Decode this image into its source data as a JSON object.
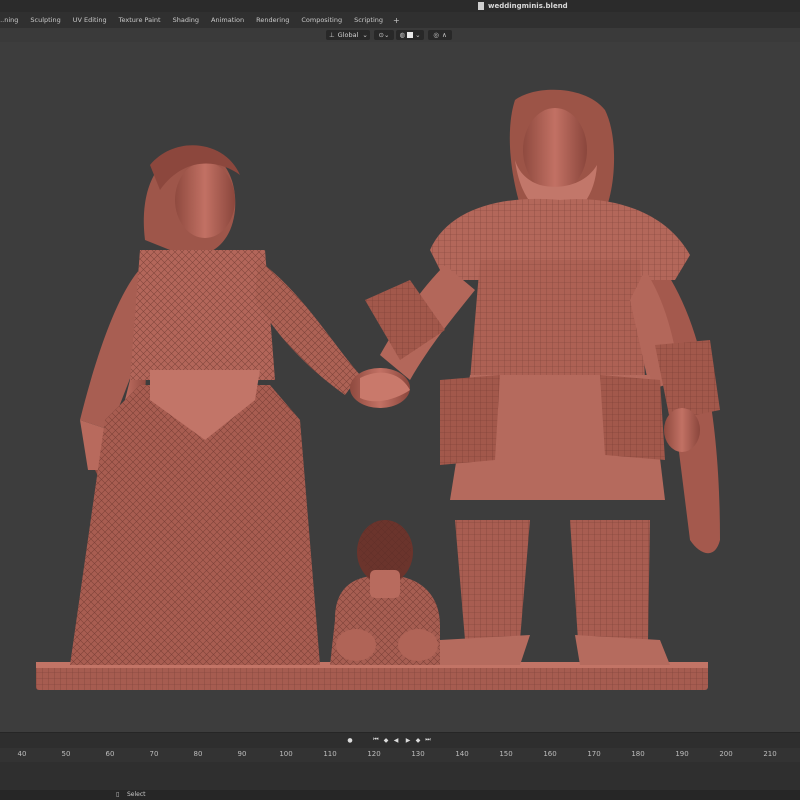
{
  "window": {
    "title": "weddingminis.blend"
  },
  "workspace_tabs": [
    "...ning",
    "Sculpting",
    "UV Editing",
    "Texture Paint",
    "Shading",
    "Animation",
    "Rendering",
    "Compositing",
    "Scripting"
  ],
  "viewport_header": {
    "orientation": "Global"
  },
  "timeline": {
    "ticks": [
      "40",
      "50",
      "60",
      "70",
      "80",
      "90",
      "100",
      "110",
      "120",
      "130",
      "140",
      "150",
      "160",
      "170",
      "180",
      "190",
      "200",
      "210"
    ]
  },
  "status": {
    "select_label": "Select"
  },
  "colors": {
    "model": "#b8675a",
    "background": "#3d3d3d"
  }
}
